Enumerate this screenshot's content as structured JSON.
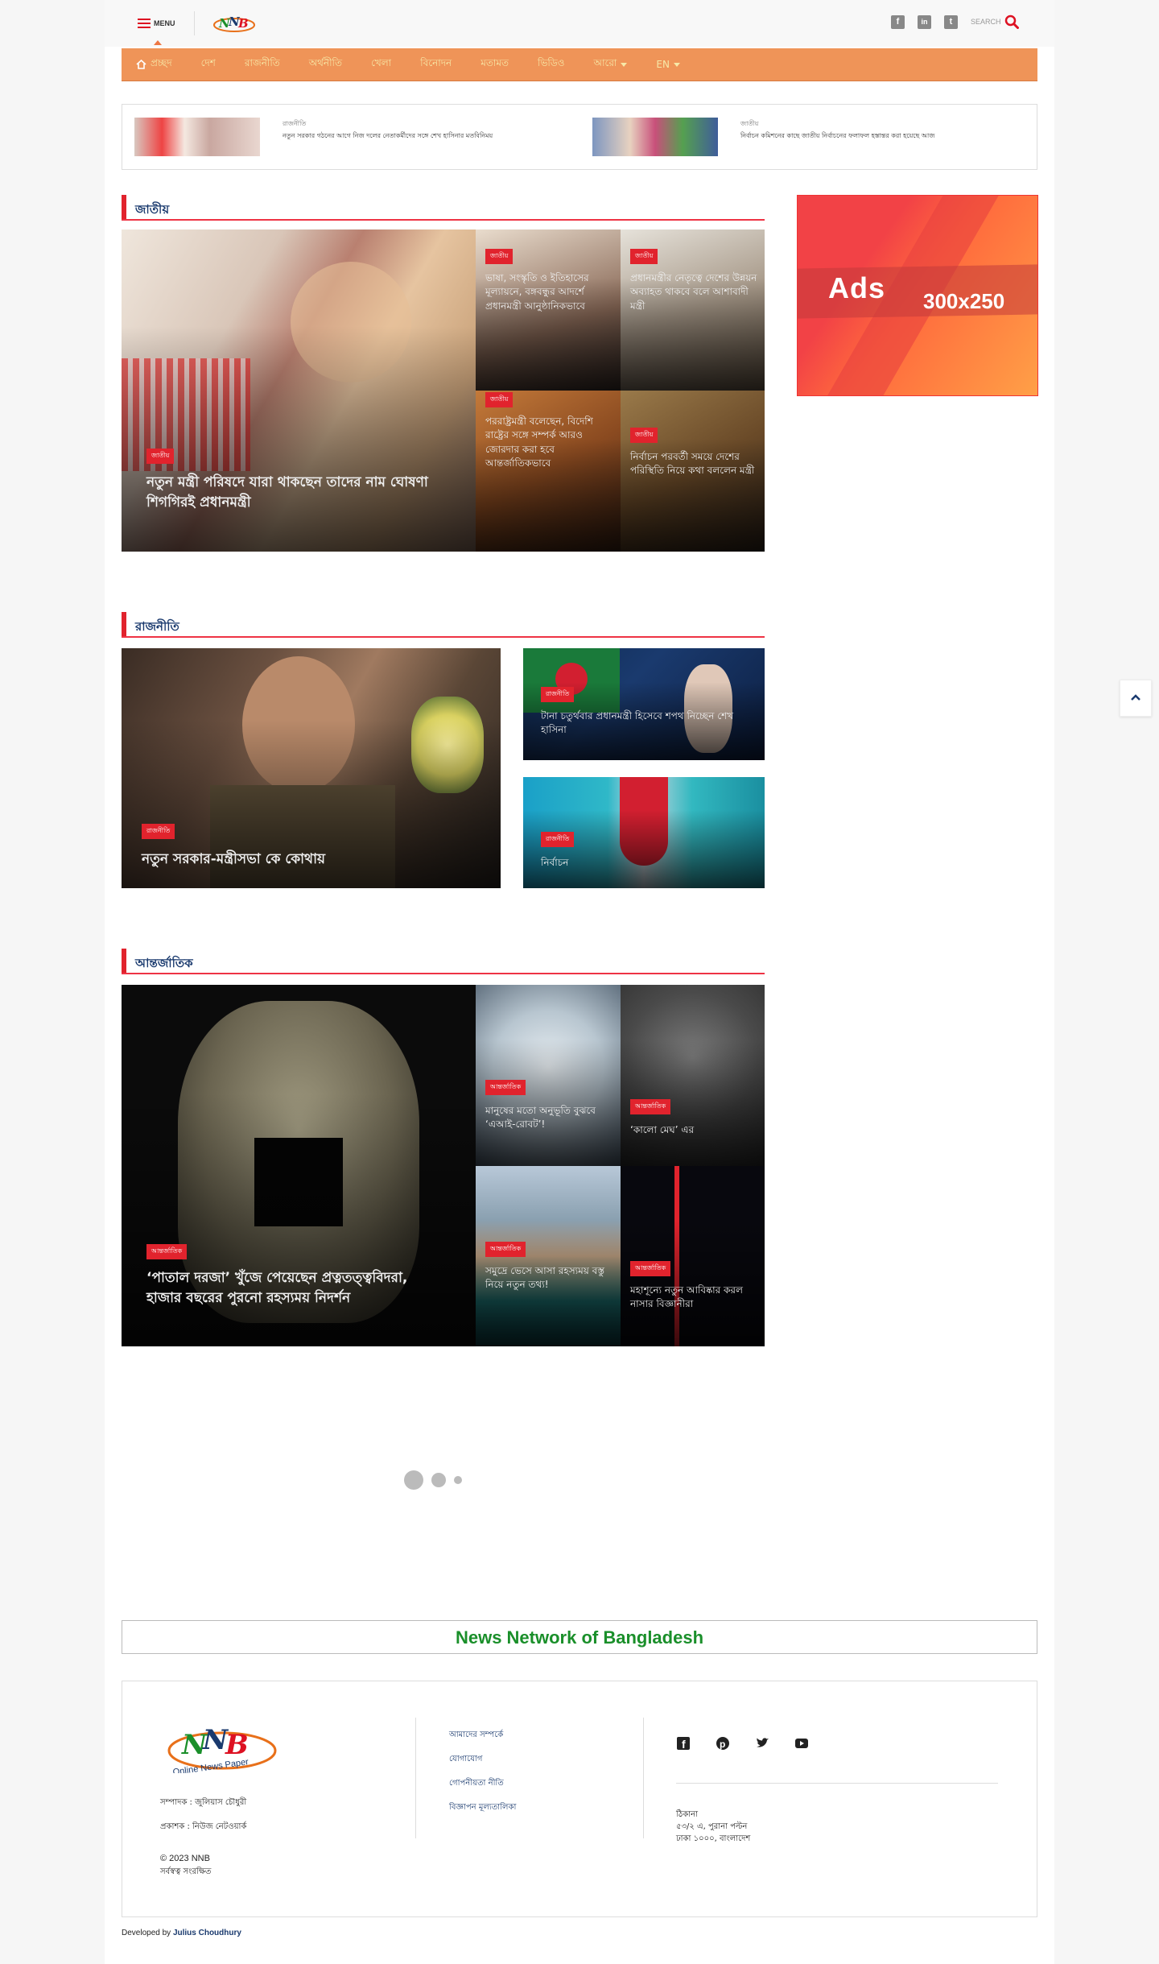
{
  "header": {
    "menu_label": "MENU",
    "search_label": "SEARCH",
    "social": [
      "facebook-icon",
      "linkedin-icon",
      "twitter-icon"
    ]
  },
  "nav": {
    "items": [
      {
        "label": "প্রচ্ছদ",
        "icon": "home-icon",
        "dropdown": false
      },
      {
        "label": "দেশ",
        "dropdown": false
      },
      {
        "label": "রাজনীতি",
        "dropdown": false
      },
      {
        "label": "অর্থনীতি",
        "dropdown": false
      },
      {
        "label": "খেলা",
        "dropdown": false
      },
      {
        "label": "বিনোদন",
        "dropdown": false
      },
      {
        "label": "মতামত",
        "dropdown": false
      },
      {
        "label": "ভিডিও",
        "dropdown": false
      },
      {
        "label": "আরো",
        "dropdown": true
      },
      {
        "label": "EN",
        "dropdown": true
      }
    ]
  },
  "strip": [
    {
      "category": "রাজনীতি",
      "title": "নতুন সরকার গঠনের আগে নিজ দলের নেতাকর্মীদের সঙ্গে শেখ হাসিনার মতবিনিময়"
    },
    {
      "category": "জাতীয়",
      "title": "নির্বাচন কমিশনের কাছে জাতীয় নির্বাচনের ফলাফল হস্তান্তর করা হয়েছে আজ"
    }
  ],
  "sections": {
    "s1": {
      "title": "জাতীয়",
      "lead": {
        "category": "জাতীয়",
        "title": "নতুন মন্ত্রী পরিষদে যারা থাকছেন তাদের নাম ঘোষণা শিগগিরই প্রধানমন্ত্রী"
      },
      "grid": [
        {
          "category": "জাতীয়",
          "title": "ভাষা, সংস্কৃতি ও ইতিহাসের মূল্যায়নে, বঙ্গবন্ধুর আদর্শে প্রধানমন্ত্রী আনুষ্ঠানিকভাবে"
        },
        {
          "category": "জাতীয়",
          "title": "প্রধানমন্ত্রীর নেতৃত্বে দেশের উন্নয়ন অব্যাহত থাকবে বলে আশাবাদী মন্ত্রী"
        },
        {
          "category": "জাতীয়",
          "title": "পররাষ্ট্রমন্ত্রী বলেছেন, বিদেশি রাষ্ট্রের সঙ্গে সম্পর্ক আরও জোরদার করা হবে আন্তর্জাতিকভাবে"
        },
        {
          "category": "জাতীয়",
          "title": "নির্বাচন পরবর্তী সময়ে দেশের পরিস্থিতি নিয়ে কথা বললেন মন্ত্রী"
        }
      ]
    },
    "s2": {
      "title": "রাজনীতি",
      "lead": {
        "category": "রাজনীতি",
        "title": "নতুন সরকার-মন্ত্রীসভা কে কোথায়"
      },
      "side": [
        {
          "category": "রাজনীতি",
          "title": "টানা চতুর্থবার প্রধানমন্ত্রী হিসেবে শপথ নিচ্ছেন শেখ হাসিনা"
        },
        {
          "category": "রাজনীতি",
          "title": "নির্বাচন"
        }
      ]
    },
    "s3": {
      "title": "আন্তর্জাতিক",
      "lead": {
        "category": "আন্তর্জাতিক",
        "title": "‘পাতাল দরজা’ খুঁজে পেয়েছেন প্রত্নতত্ত্ববিদরা, হাজার বছরের পুরনো রহস্যময় নিদর্শন"
      },
      "grid": [
        {
          "category": "আন্তর্জাতিক",
          "title": "মানুষের মতো অনুভূতি বুঝবে ‘এআই-রোবট’!"
        },
        {
          "category": "আন্তর্জাতিক",
          "title": "‘কালো মেঘ’ এর"
        },
        {
          "category": "আন্তর্জাতিক",
          "title": "সমুদ্রে ভেসে আসা রহস্যময় বস্তু নিয়ে নতুন তথ্য!"
        },
        {
          "category": "আন্তর্জাতিক",
          "title": "মহাশূন্যে নতুন আবিষ্কার করল নাসার বিজ্ঞানীরা"
        }
      ]
    }
  },
  "ads": {
    "label": "Ads",
    "size": "300x250"
  },
  "brand_banner": "News Network of Bangladesh",
  "footer": {
    "logo_text": "NNB",
    "logo_tagline": "Online News Paper",
    "editor_line1": "সম্পাদক : জুলিয়াস চৌধুরী",
    "editor_line2": "প্রকাশক : নিউজ নেটওয়ার্ক",
    "copyright": "© 2023 NNB",
    "rights": "সর্বস্বত্ব সংরক্ষিত",
    "links": [
      "আমাদের সম্পর্কে",
      "যোগাযোগ",
      "গোপনীয়তা নীতি",
      "বিজ্ঞাপন মূল্যতালিকা"
    ],
    "social": [
      "facebook-icon",
      "pinterest-icon",
      "twitter-icon",
      "youtube-icon"
    ],
    "address_title": "ঠিকানা",
    "address_line1": "৫৩/২ এ, পুরানা পল্টন",
    "address_line2": "ঢাকা ১০০০, বাংলাদেশ",
    "developed_by_label": "Developed by",
    "developer": "Julius Choudhury"
  }
}
